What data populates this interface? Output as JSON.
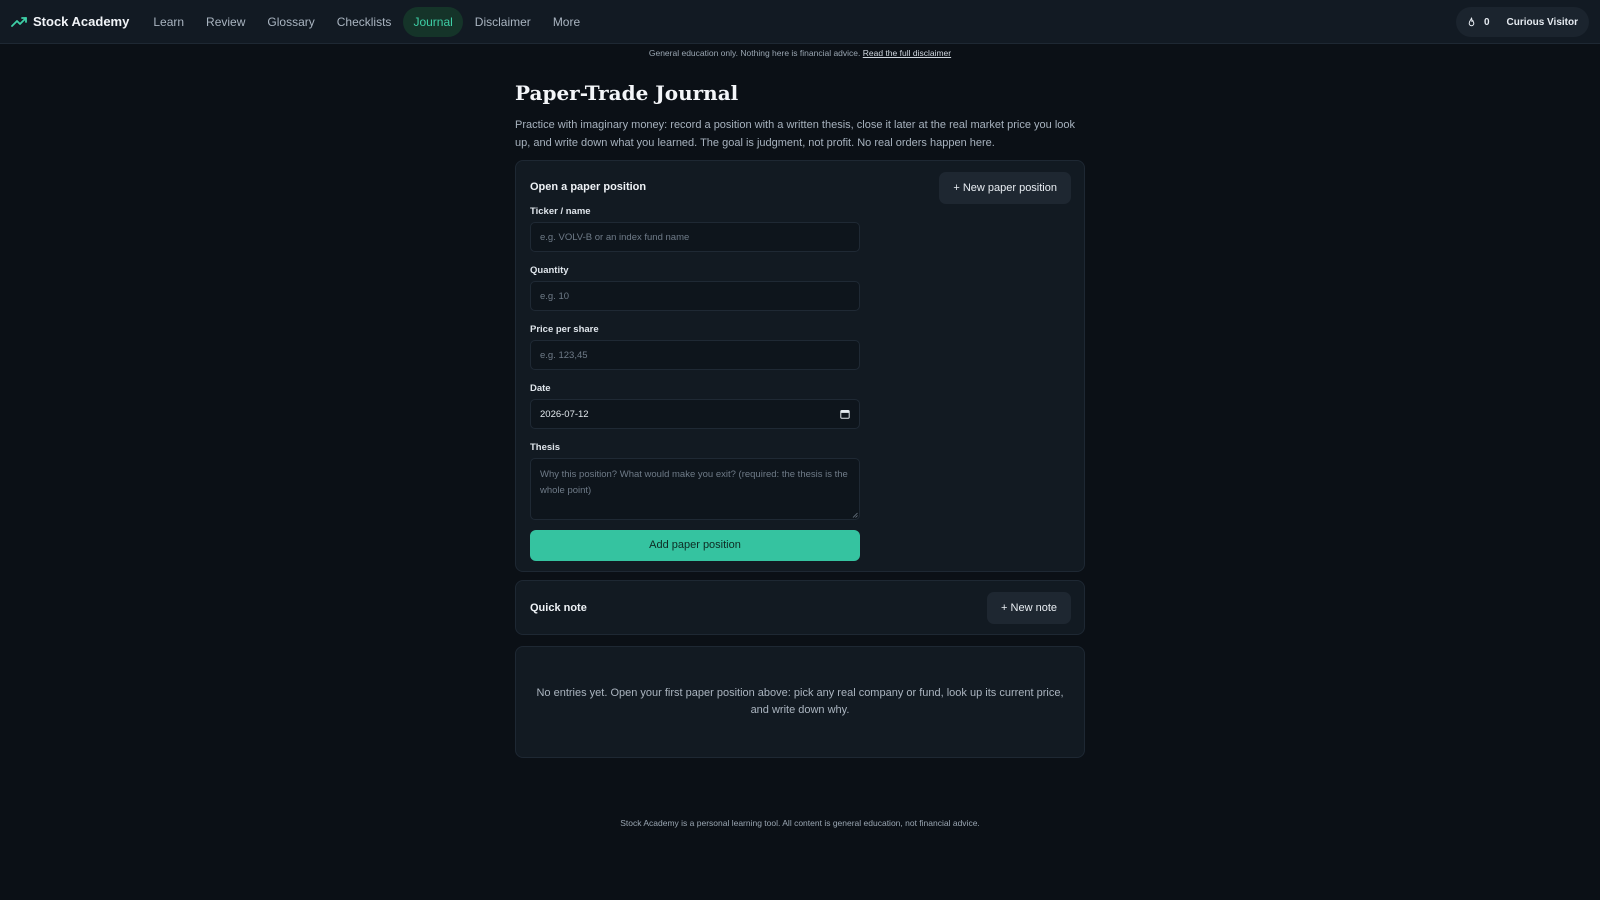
{
  "brand": {
    "name": "Stock Academy",
    "icon": "trending-up-icon",
    "accent": "#3ecfa6"
  },
  "nav": {
    "items": [
      {
        "label": "Learn"
      },
      {
        "label": "Review"
      },
      {
        "label": "Glossary"
      },
      {
        "label": "Checklists"
      },
      {
        "label": "Journal",
        "active": true
      },
      {
        "label": "Disclaimer"
      },
      {
        "label": "More"
      }
    ]
  },
  "user": {
    "streak_icon": "flame-icon",
    "streak": "0",
    "name": "Curious Visitor"
  },
  "disclaimer_bar": {
    "text": "General education only. Nothing here is financial advice.",
    "link": "Read the full disclaimer"
  },
  "page": {
    "title": "Paper-Trade Journal",
    "intro": "Practice with imaginary money: record a position with a written thesis, close it later at the real market price you look up, and write down what you learned. The goal is judgment, not profit. No real orders happen here."
  },
  "open_position": {
    "heading": "Open a paper position",
    "new_button": "+ New paper position",
    "fields": {
      "ticker": {
        "label": "Ticker / name",
        "placeholder": "e.g. VOLV-B or an index fund name"
      },
      "quantity": {
        "label": "Quantity",
        "placeholder": "e.g. 10"
      },
      "price": {
        "label": "Price per share",
        "placeholder": "e.g. 123,45"
      },
      "date": {
        "label": "Date",
        "value": "2026-07-12"
      },
      "thesis": {
        "label": "Thesis",
        "placeholder": "Why this position? What would make you exit? (required: the thesis is the whole point)"
      }
    },
    "submit": "Add paper position"
  },
  "quick_note": {
    "heading": "Quick note",
    "new_button": "+ New note"
  },
  "empty_state": "No entries yet. Open your first paper position above: pick any real company or fund, look up its current price, and write down why.",
  "footer": "Stock Academy is a personal learning tool. All content is general education, not financial advice."
}
